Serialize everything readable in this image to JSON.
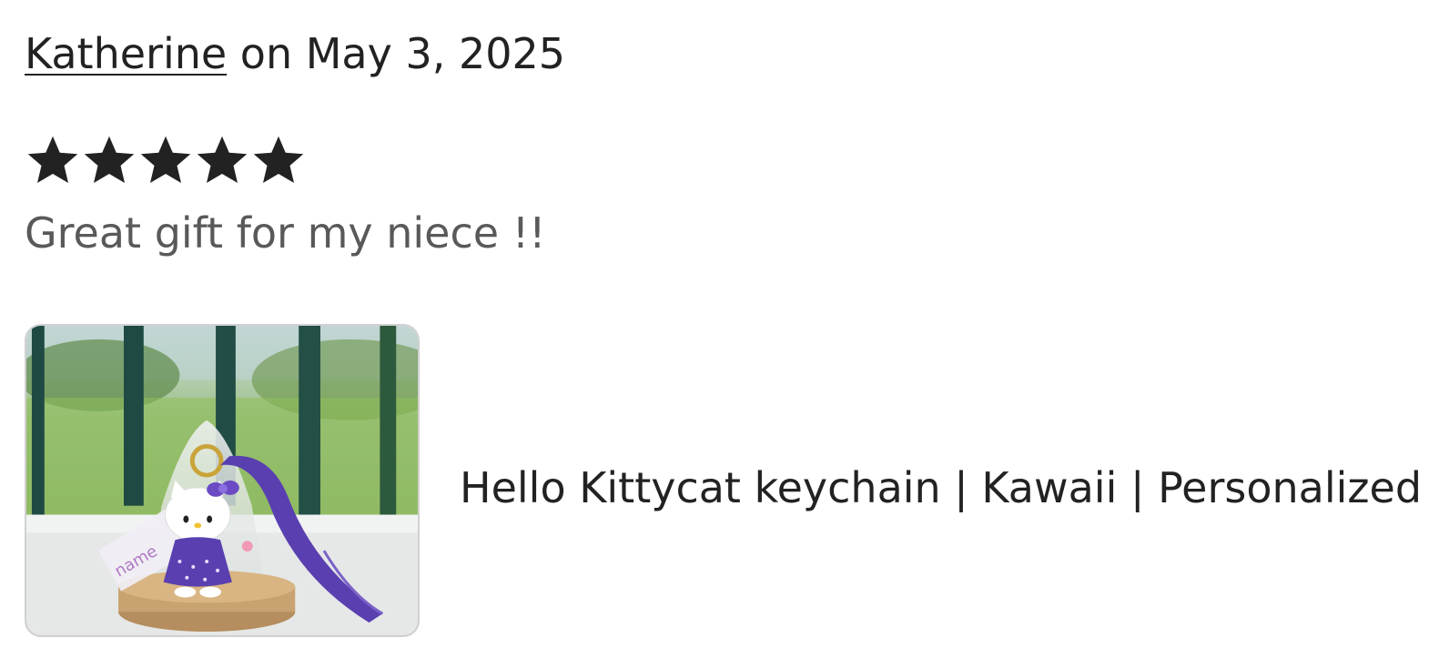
{
  "review": {
    "reviewer_name": "Katherine",
    "date_text": " on May 3, 2025",
    "rating": 5,
    "rating_max": 5,
    "body": "Great gift for my niece !!"
  },
  "listing": {
    "title": "Hello Kittycat keychain | Kawaii | Personalized",
    "image_alt": "keychain-photo"
  },
  "colors": {
    "text": "#222222",
    "muted_text": "#595959",
    "star": "#222222",
    "image_border": "#d0d0d0",
    "strap_purple": "#5a3fb0"
  },
  "icons": {
    "star": "star-filled-icon"
  }
}
